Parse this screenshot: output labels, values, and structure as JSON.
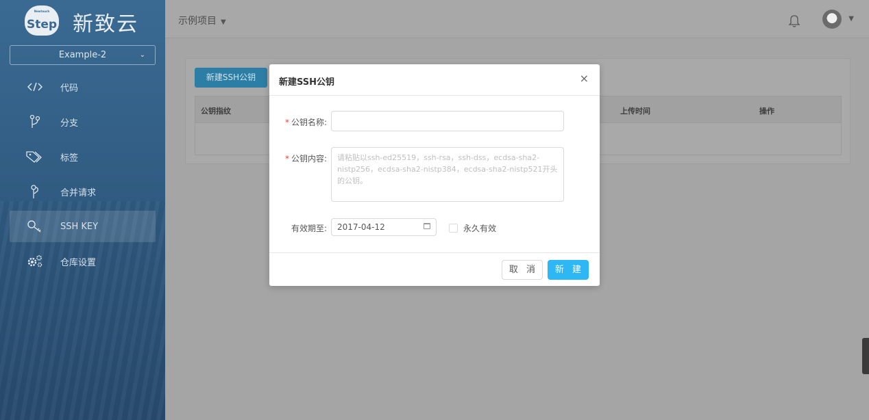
{
  "brand": {
    "logo_text": "Step",
    "logo_sub": "Newtouch",
    "name": "新致云"
  },
  "project_select": {
    "value": "Example-2"
  },
  "nav": {
    "items": [
      {
        "label": "代码",
        "icon": "code-icon"
      },
      {
        "label": "分支",
        "icon": "branch-icon"
      },
      {
        "label": "标签",
        "icon": "tag-icon"
      },
      {
        "label": "合并请求",
        "icon": "merge-request-icon"
      },
      {
        "label": "SSH KEY",
        "icon": "key-icon",
        "active": true
      },
      {
        "label": "仓库设置",
        "icon": "gear-icon"
      }
    ]
  },
  "topbar": {
    "project_name": "示例项目"
  },
  "page": {
    "new_key_button": "新建SSH公钥",
    "table_headers": [
      "公钥指纹",
      "上传时间",
      "操作"
    ]
  },
  "modal": {
    "title": "新建SSH公钥",
    "close": "×",
    "name_label": "公钥名称:",
    "content_label": "公钥内容:",
    "content_placeholder": "请粘贴以ssh-ed25519，ssh-rsa，ssh-dss，ecdsa-sha2-nistp256，ecdsa-sha2-nistp384，ecdsa-sha2-nistp521开头的公钥。",
    "expiry_label": "有效期至:",
    "expiry_value": "2017-04-12",
    "permanent_label": "永久有效",
    "cancel": "取 消",
    "confirm": "新 建"
  },
  "colors": {
    "primary": "#2db7f5",
    "sidebar": "#335f86",
    "required": "#f04134"
  }
}
